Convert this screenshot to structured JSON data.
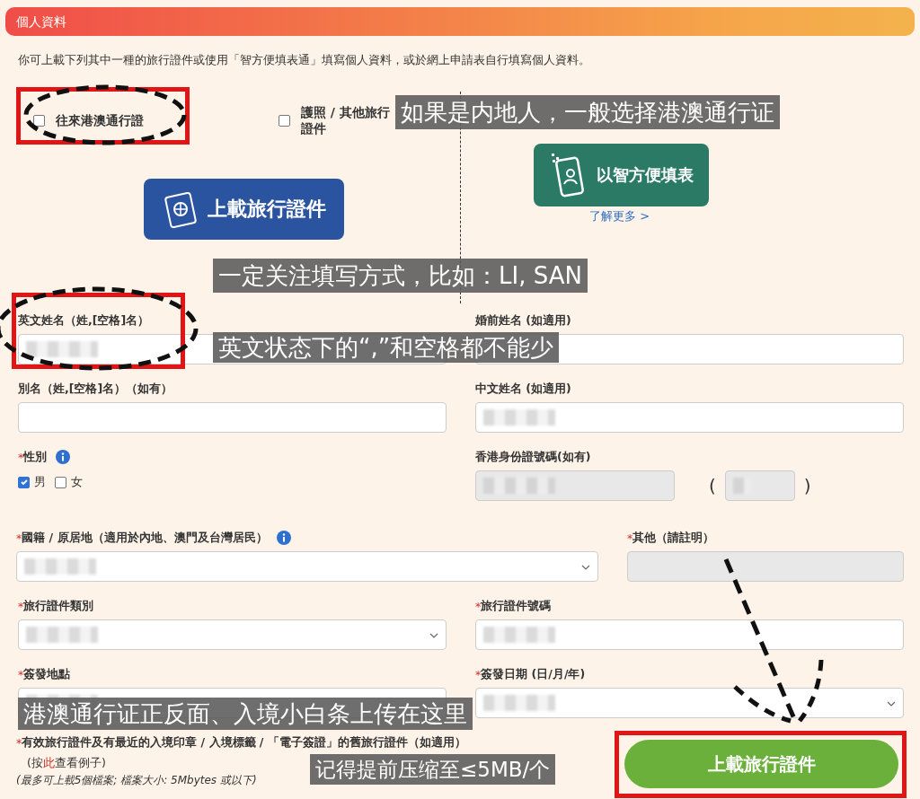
{
  "header": {
    "title": "個人資料"
  },
  "intro": "你可上載下列其中一種的旅行證件或使用「智方便填表通」填寫個人資料，或於網上申請表自行填寫個人資料。",
  "document_options": [
    {
      "label": "往來港澳通行證",
      "checked": false
    },
    {
      "label": "護照 / 其他旅行證件",
      "checked": false
    }
  ],
  "upload_travel_doc_button": "上載旅行證件",
  "smart_fill": {
    "button": "以智方便填表",
    "link": "了解更多 >"
  },
  "rows": [
    {
      "fields": [
        {
          "kind": "text",
          "label": "英文姓名（姓,[空格]名）",
          "blurred": true
        },
        {
          "kind": "text",
          "label": "婚前姓名 (如適用)"
        }
      ]
    },
    {
      "fields": [
        {
          "kind": "text",
          "label": "別名（姓,[空格]名）（如有）",
          "blurred": false
        },
        {
          "kind": "text",
          "label": "中文姓名 (如適用)",
          "blurred": true
        }
      ]
    },
    {
      "fields": [
        {
          "kind": "gender",
          "label": "性別",
          "required_mark": "*",
          "info": true,
          "options": [
            {
              "label": "男",
              "checked": true
            },
            {
              "label": "女",
              "checked": false
            }
          ]
        },
        {
          "kind": "hkid",
          "label": "香港身份證號碼(如有)",
          "blurred": true,
          "open_paren": "(",
          "close_paren": ")"
        }
      ]
    },
    {
      "fields": [
        {
          "kind": "select",
          "label": "國籍 / 原居地（適用於內地、澳門及台灣居民）",
          "required_mark": "*",
          "info": true,
          "blurred": true
        },
        {
          "kind": "disabled",
          "label": "其他（請註明）",
          "required_mark": "*",
          "blurred": false
        }
      ]
    },
    {
      "fields": [
        {
          "kind": "select",
          "label": "旅行證件類別",
          "required_mark": "*",
          "blurred": true
        },
        {
          "kind": "text",
          "label": "旅行證件號碼",
          "required_mark": "*",
          "blurred": true
        }
      ]
    },
    {
      "fields": [
        {
          "kind": "text",
          "label": "簽發地點",
          "required_mark": "*",
          "blurred": true
        },
        {
          "kind": "select",
          "label": "簽發日期 (日/月/年)",
          "required_mark": "*",
          "blurred": true
        }
      ]
    }
  ],
  "upload_section": {
    "label": "有效旅行證件及有最近的入境印章 / 入境標籤 / 「電子簽證」的舊旅行證件（如適用）",
    "required_mark": "*",
    "hint_before": "(按",
    "hint_link": "此",
    "hint_after": "查看例子)",
    "note": "(最多可上載5個檔案; 檔案大小: 5Mbytes 或以下)",
    "button": "上載旅行證件"
  },
  "captions": [
    "如果是内地人，一般选择港澳通行证",
    "一定关注填写方式，比如：LI, SAN",
    "英文状态下的“,”和空格都不能少",
    "港澳通行证正反面、入境小白条上传在这里",
    "记得提前压缩至≤5MB/个"
  ]
}
